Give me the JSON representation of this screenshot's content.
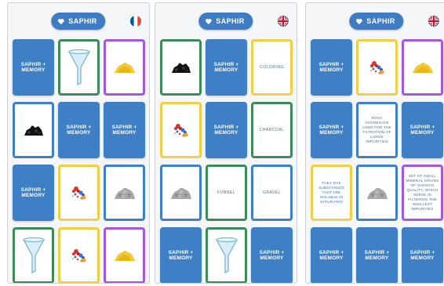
{
  "app": {
    "title": "SAPHIR",
    "back_label": "SAPHIR +\nMEMORY"
  },
  "screens": [
    {
      "language": "French",
      "cards": [
        {
          "type": "back"
        },
        {
          "type": "image",
          "icon": "funnel-icon",
          "border": "green"
        },
        {
          "type": "image",
          "icon": "sand-pile-icon",
          "border": "purple"
        },
        {
          "type": "image",
          "icon": "charcoal-icon",
          "border": "blue"
        },
        {
          "type": "back"
        },
        {
          "type": "back"
        },
        {
          "type": "back"
        },
        {
          "type": "image",
          "icon": "colored-particles-icon",
          "border": "yellow"
        },
        {
          "type": "image",
          "icon": "gravel-icon",
          "border": "blue"
        },
        {
          "type": "image",
          "icon": "funnel-icon",
          "border": "green"
        },
        {
          "type": "image",
          "icon": "colored-particles-icon",
          "border": "yellow"
        },
        {
          "type": "image",
          "icon": "sand-pile-icon",
          "border": "purple"
        }
      ]
    },
    {
      "language": "English",
      "cards": [
        {
          "type": "image",
          "icon": "charcoal-icon",
          "border": "green"
        },
        {
          "type": "back"
        },
        {
          "type": "text",
          "text": "COLORING",
          "border": "yellow"
        },
        {
          "type": "image",
          "icon": "colored-particles-icon",
          "border": "yellow"
        },
        {
          "type": "back"
        },
        {
          "type": "text",
          "text": "CHARCOAL",
          "border": "green"
        },
        {
          "type": "image",
          "icon": "gravel-icon",
          "border": "blue"
        },
        {
          "type": "text",
          "text": "FUNNEL",
          "border": "green"
        },
        {
          "type": "text",
          "text": "GRAVEL",
          "border": "blue"
        },
        {
          "type": "back"
        },
        {
          "type": "image",
          "icon": "funnel-icon",
          "border": "green"
        },
        {
          "type": "back"
        }
      ]
    },
    {
      "language": "English",
      "cards": [
        {
          "type": "back"
        },
        {
          "type": "image",
          "icon": "colored-particles-icon",
          "border": "yellow"
        },
        {
          "type": "image",
          "icon": "sand-pile-icon",
          "border": "purple"
        },
        {
          "type": "back"
        },
        {
          "type": "desc",
          "text": "ROCK AGGREGATE USED FOR THE FILTRATION OF LARGE IMPURITIES",
          "border": "blue"
        },
        {
          "type": "back"
        },
        {
          "type": "desc",
          "text": "THEY DYE SUBSTANCES THAT ARE SOLUBLE IN SATURATED",
          "border": "yellow"
        },
        {
          "type": "image",
          "icon": "gravel-icon",
          "border": "blue"
        },
        {
          "type": "desc",
          "text": "SET OF SMALL MINERAL GRAINS OF VARIOUS QUALITY, WHICH SERVE IN FILTERING THE SMALLEST IMPURITIES",
          "border": "purple"
        },
        {
          "type": "back"
        },
        {
          "type": "back"
        },
        {
          "type": "back"
        }
      ]
    }
  ],
  "colors": {
    "accent": "#3f7fc6",
    "green": "#3f8a5a",
    "blue": "#3f7fc6",
    "purple": "#a259d9",
    "yellow": "#f0cf48"
  }
}
